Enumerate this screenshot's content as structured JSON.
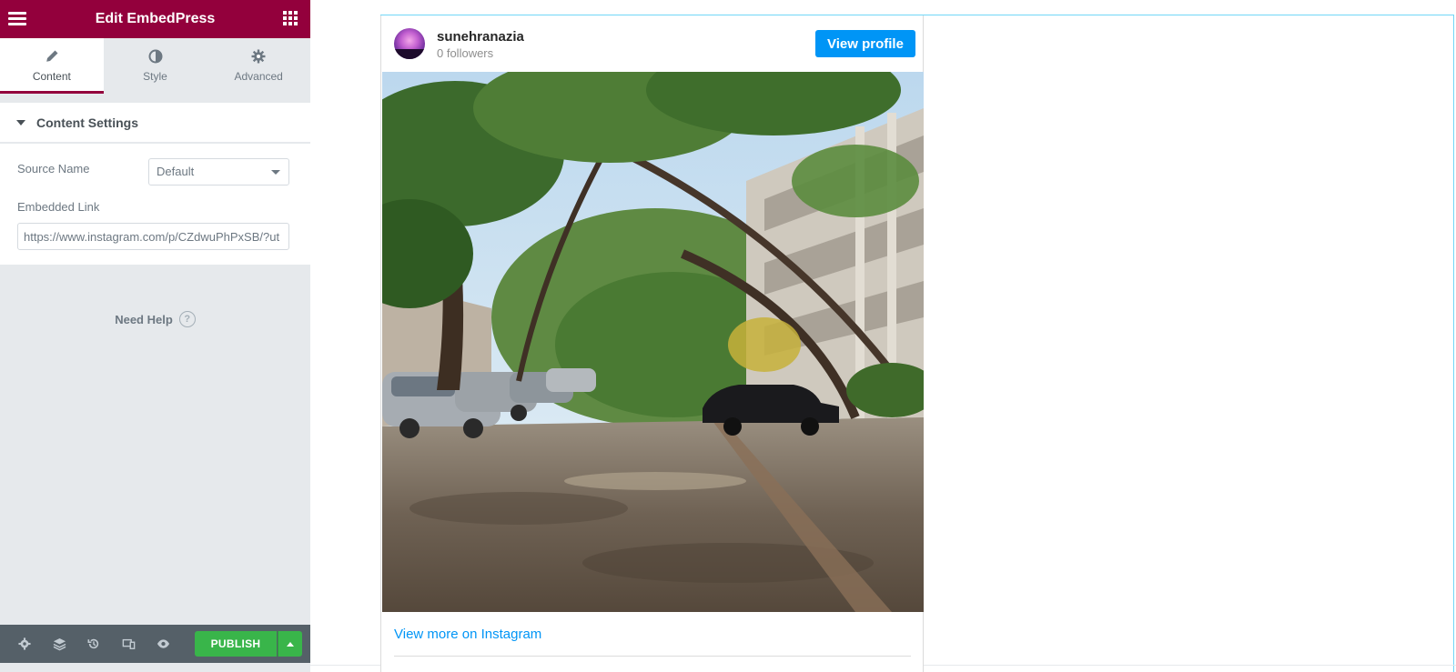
{
  "panel": {
    "title": "Edit EmbedPress",
    "tabs": [
      {
        "label": "Content",
        "icon": "pencil-icon"
      },
      {
        "label": "Style",
        "icon": "half-circle-icon"
      },
      {
        "label": "Advanced",
        "icon": "gear-icon"
      }
    ],
    "section_title": "Content Settings",
    "source_name_label": "Source Name",
    "source_name_value": "Default",
    "embedded_link_label": "Embedded Link",
    "embedded_link_value": "https://www.instagram.com/p/CZdwuPhPxSB/?ut",
    "help_label": "Need Help",
    "help_icon": "?",
    "publish_label": "PUBLISH",
    "accent_color": "#93003c",
    "publish_color": "#39b54a"
  },
  "instagram": {
    "username": "sunehranazia",
    "followers": "0 followers",
    "view_profile_label": "View profile",
    "view_more_label": "View more on Instagram",
    "button_color": "#0095f6"
  }
}
